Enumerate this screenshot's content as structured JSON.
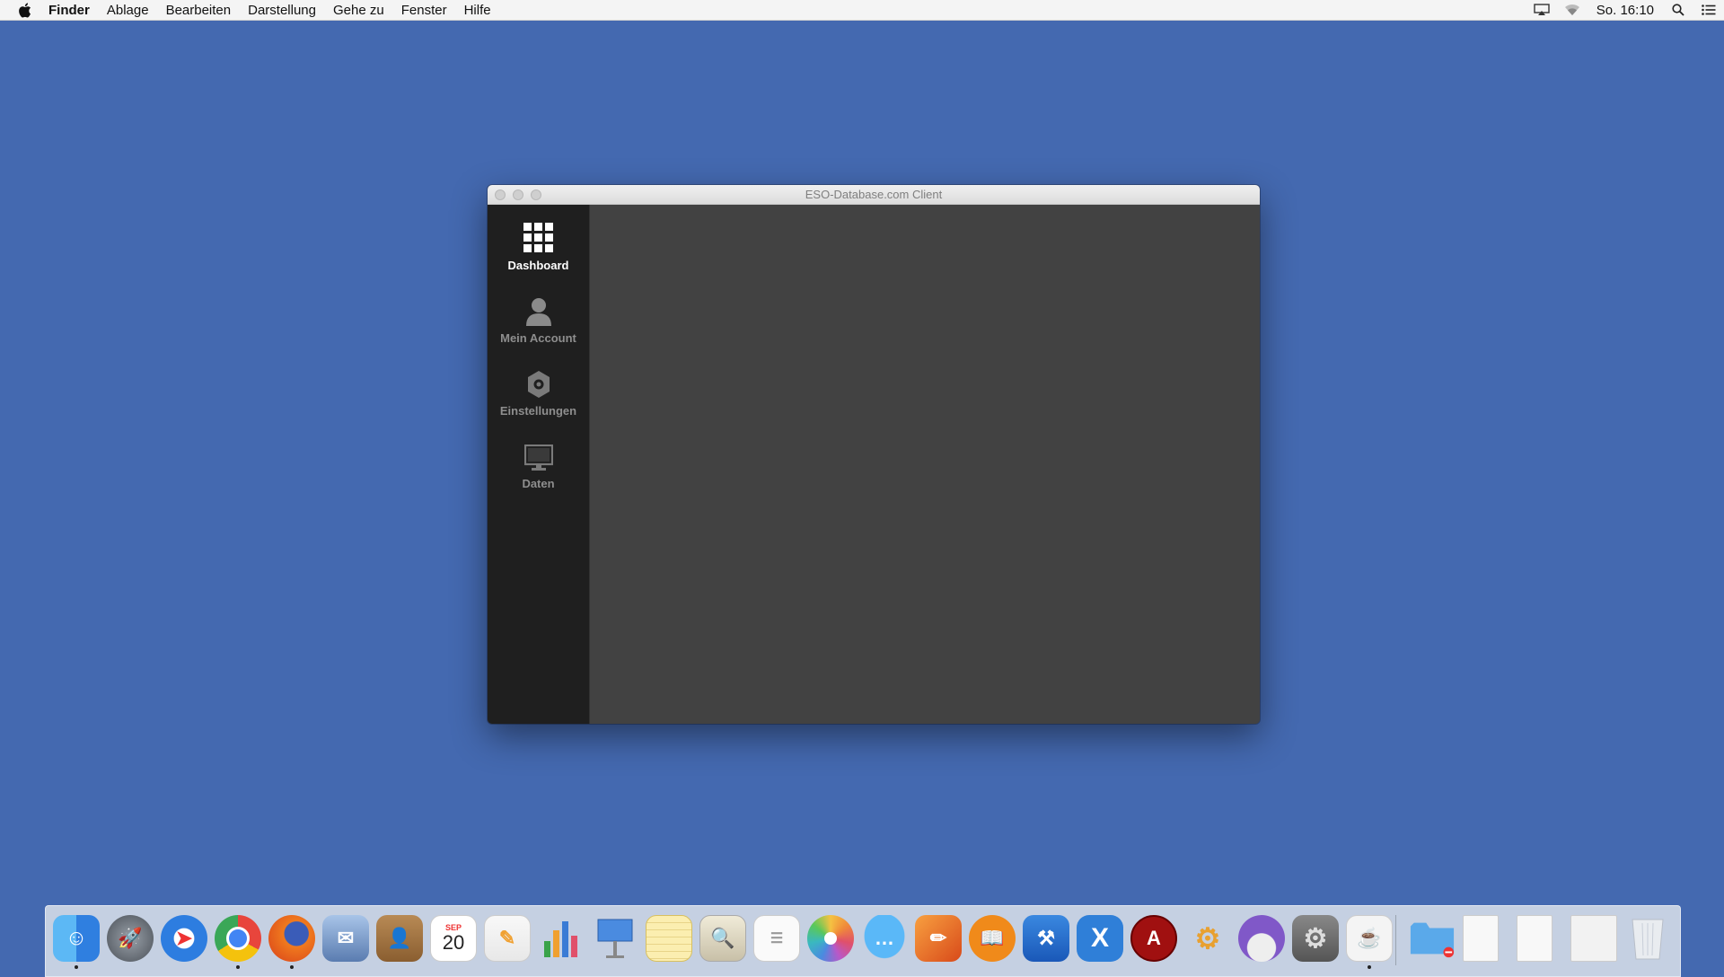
{
  "menubar": {
    "app_name": "Finder",
    "items": [
      "Ablage",
      "Bearbeiten",
      "Darstellung",
      "Gehe zu",
      "Fenster",
      "Hilfe"
    ],
    "clock": "So. 16:10",
    "status_icons": [
      "airplay-icon",
      "wifi-icon",
      "spotlight-search-icon",
      "notification-center-icon"
    ]
  },
  "window": {
    "title": "ESO-Database.com Client",
    "nav": [
      {
        "label": "Dashboard",
        "icon": "grid-icon",
        "active": true
      },
      {
        "label": "Mein Account",
        "icon": "user-icon",
        "active": false
      },
      {
        "label": "Einstellungen",
        "icon": "gear-icon",
        "active": false
      },
      {
        "label": "Daten",
        "icon": "monitor-icon",
        "active": false
      }
    ]
  },
  "dock": {
    "apps": [
      {
        "name": "finder-icon",
        "color": "#3a8ee6",
        "running": true
      },
      {
        "name": "launchpad-icon",
        "color": "#5f6670"
      },
      {
        "name": "safari-icon",
        "color": "#2d7de0"
      },
      {
        "name": "chrome-icon",
        "color": "#e8453c",
        "running": true
      },
      {
        "name": "firefox-icon",
        "color": "#e5631f",
        "running": true
      },
      {
        "name": "mail-icon",
        "color": "#6b89b8"
      },
      {
        "name": "contacts-icon",
        "color": "#a57a45"
      },
      {
        "name": "calendar-icon",
        "color": "#ffffff",
        "month": "SEP",
        "day": "20"
      },
      {
        "name": "pages-icon",
        "color": "#f0a030"
      },
      {
        "name": "numbers-icon",
        "color": "#3aa34a"
      },
      {
        "name": "keynote-icon",
        "color": "#3a7bd5"
      },
      {
        "name": "notes-icon",
        "color": "#f4e27a"
      },
      {
        "name": "preview-icon",
        "color": "#d8d0b8"
      },
      {
        "name": "reminders-icon",
        "color": "#f5f5f5"
      },
      {
        "name": "photos-icon",
        "color": "#e0506a"
      },
      {
        "name": "messages-icon",
        "color": "#3b9ef0"
      },
      {
        "name": "sketchbook-icon",
        "color": "#e86a2a"
      },
      {
        "name": "ibooks-icon",
        "color": "#f08a1a"
      },
      {
        "name": "xcode-icon",
        "color": "#2a6fc8"
      },
      {
        "name": "xampp-icon",
        "color": "#2f7fd8"
      },
      {
        "name": "adobe-icon",
        "color": "#a01010"
      },
      {
        "name": "blender-icon",
        "color": "#e8a030"
      },
      {
        "name": "instruments-icon",
        "color": "#8058c8"
      },
      {
        "name": "system-preferences-icon",
        "color": "#6a6a6a"
      },
      {
        "name": "java-icon",
        "color": "#e9e9e9",
        "running": true
      }
    ],
    "stack": [
      {
        "name": "folder-icon",
        "color": "#5aa9ea"
      },
      {
        "name": "document-icon",
        "color": "#f8f8f8"
      },
      {
        "name": "document-2-icon",
        "color": "#f8f8f8"
      },
      {
        "name": "chrome-document-icon",
        "color": "#f2f2f2"
      },
      {
        "name": "trash-icon",
        "color": "#e6e9ee"
      }
    ]
  }
}
